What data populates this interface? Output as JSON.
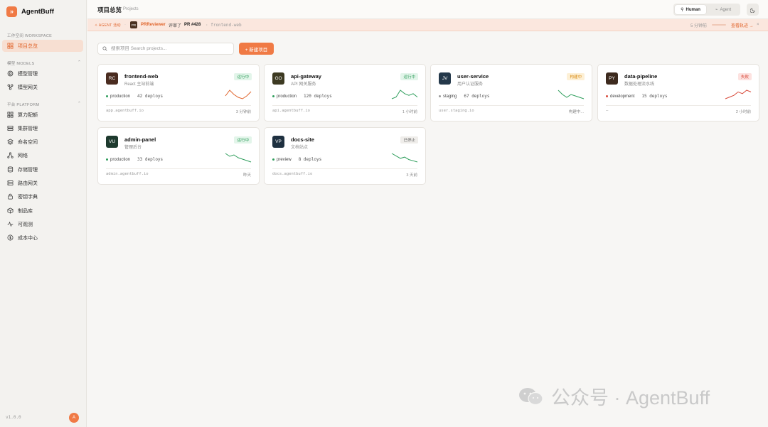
{
  "app": {
    "name": "AgentBuff",
    "logo_glyph": "»",
    "version": "v1.0.0",
    "user_initial": "A",
    "accent": "#f07a45"
  },
  "sidebar": {
    "sections": [
      {
        "label": "工作空间 WORKSPACE",
        "items": [
          {
            "label": "项目总览",
            "icon": "grid-icon",
            "active": true
          }
        ]
      },
      {
        "label": "模型 MODELS",
        "items": [
          {
            "label": "模型管理",
            "icon": "target-icon"
          },
          {
            "label": "模型网关",
            "icon": "network-icon"
          }
        ]
      },
      {
        "label": "平台 PLATFORM",
        "items": [
          {
            "label": "算力配额",
            "icon": "grid-icon"
          },
          {
            "label": "集群管理",
            "icon": "server-icon"
          },
          {
            "label": "命名空间",
            "icon": "layers-icon"
          },
          {
            "label": "网络",
            "icon": "share-icon"
          },
          {
            "label": "存储管理",
            "icon": "database-icon"
          },
          {
            "label": "路由网关",
            "icon": "route-icon"
          },
          {
            "label": "密钥字典",
            "icon": "lock-icon"
          },
          {
            "label": "制品库",
            "icon": "package-icon"
          },
          {
            "label": "可观测",
            "icon": "activity-icon"
          },
          {
            "label": "成本中心",
            "icon": "dollar-icon"
          }
        ]
      }
    ]
  },
  "header": {
    "title": "项目总览",
    "subtitle": "Projects",
    "mode_human": "Human",
    "mode_agent": "Agent"
  },
  "banner": {
    "tag": "✧ AGENT 活动",
    "avatar": "PR",
    "agent": "PRReviewer",
    "action": "评审了",
    "pr": "PR #428",
    "repo": "· frontend-web",
    "time": "5 分钟前",
    "view": "查看轨迹 →",
    "close": "×"
  },
  "toolbar": {
    "search_placeholder": "搜索项目 Search projects...",
    "new_label": "+ 新建项目"
  },
  "projects": [
    {
      "initials": "RC",
      "avatar_color": "#4a2c20",
      "name": "frontend-web",
      "desc": "React 主站前端",
      "status": "运行中",
      "status_kind": "run",
      "env": "production",
      "env_color": "#2f9e5c",
      "deploys": "42 deploys",
      "host": "app.agentbuff.io",
      "time": "3 分钟前",
      "spark": [
        5,
        9,
        6,
        4,
        3,
        5,
        8
      ],
      "spark_color": "#e0642b"
    },
    {
      "initials": "GO",
      "avatar_color": "#3d3a22",
      "name": "api-gateway",
      "desc": "API 网关服务",
      "status": "运行中",
      "status_kind": "run",
      "env": "production",
      "env_color": "#2f9e5c",
      "deploys": "120 deploys",
      "host": "api.agentbuff.io",
      "time": "1 小时前",
      "spark": [
        3,
        4,
        8,
        6,
        5,
        6,
        4
      ],
      "spark_color": "#2f9e5c"
    },
    {
      "initials": "JV",
      "avatar_color": "#24384a",
      "name": "user-service",
      "desc": "用户认证服务",
      "status": "构建中",
      "status_kind": "build",
      "env": "staging",
      "env_color": "#999999",
      "deploys": "67 deploys",
      "host": "user.staging.io",
      "time": "构建中...",
      "spark": [
        9,
        6,
        4,
        6,
        5,
        4,
        3
      ],
      "spark_color": "#2f9e5c"
    },
    {
      "initials": "PY",
      "avatar_color": "#3d2a1e",
      "name": "data-pipeline",
      "desc": "数据处理流水线",
      "status": "失败",
      "status_kind": "fail",
      "env": "development",
      "env_color": "#d84a3a",
      "deploys": "15 deploys",
      "host": "—",
      "time": "2 小时前",
      "spark": [
        3,
        4,
        5,
        7,
        6,
        8,
        7
      ],
      "spark_color": "#d84a3a"
    },
    {
      "initials": "VU",
      "avatar_color": "#1e3a2e",
      "name": "admin-panel",
      "desc": "管理后台",
      "status": "运行中",
      "status_kind": "run",
      "env": "production",
      "env_color": "#2f9e5c",
      "deploys": "33 deploys",
      "host": "admin.agentbuff.io",
      "time": "昨天",
      "spark": [
        8,
        6,
        7,
        5,
        4,
        3,
        2
      ],
      "spark_color": "#2f9e5c"
    },
    {
      "initials": "VP",
      "avatar_color": "#1e3040",
      "name": "docs-site",
      "desc": "文档站点",
      "status": "已停止",
      "status_kind": "stop",
      "env": "preview",
      "env_color": "#2f9e5c",
      "deploys": "8 deploys",
      "host": "docs.agentbuff.io",
      "time": "3 天前",
      "spark": [
        9,
        7,
        5,
        6,
        4,
        3,
        2
      ],
      "spark_color": "#2f9e5c"
    }
  ],
  "watermark": "公众号 · AgentBuff"
}
